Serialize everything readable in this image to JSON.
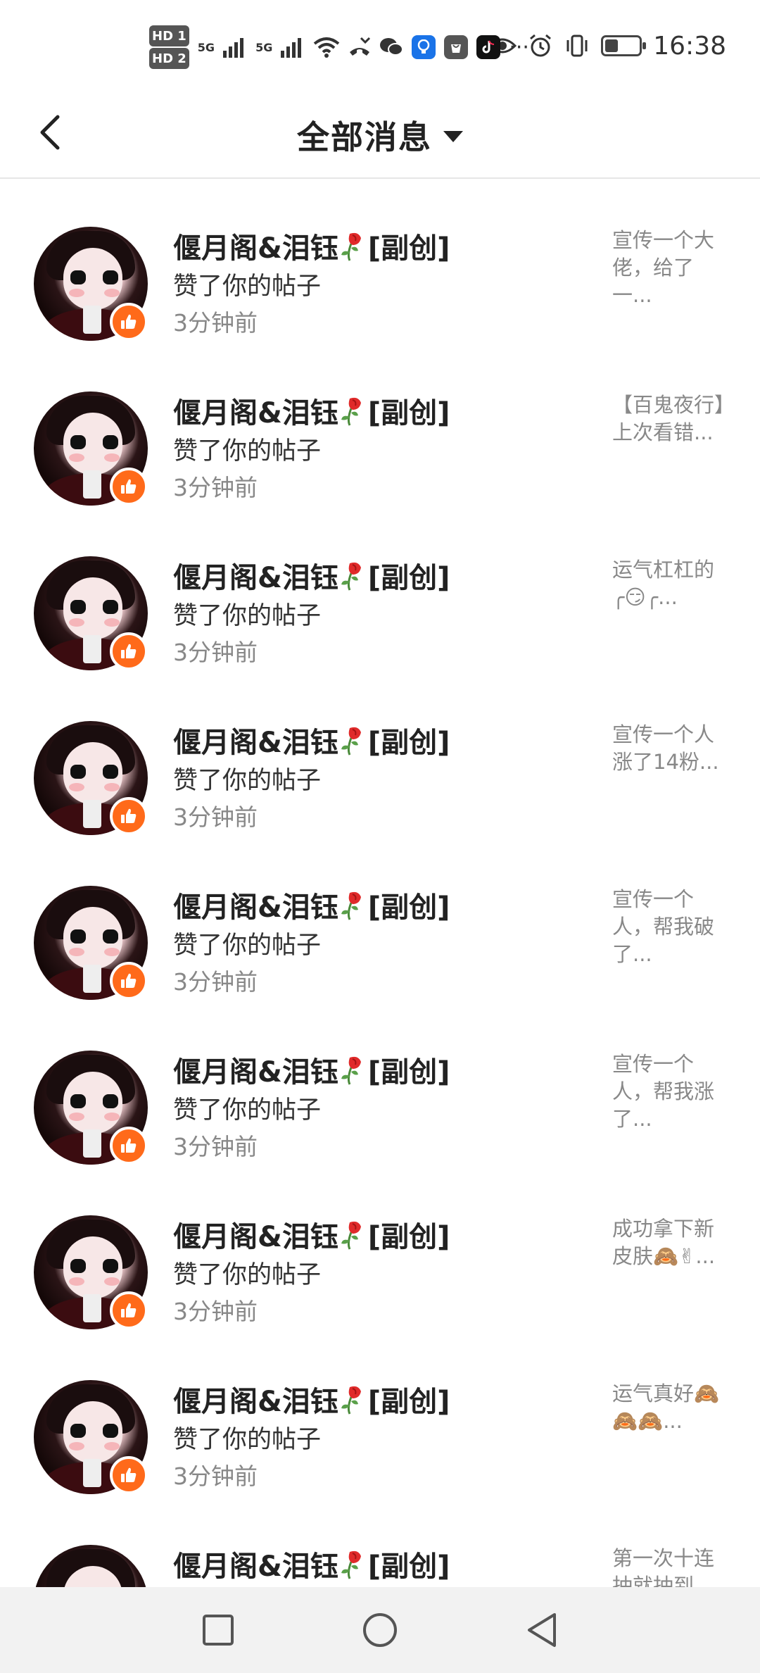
{
  "status_bar": {
    "sim1": "HD 1",
    "sim2": "HD 2",
    "net1": "5G",
    "net2": "5G",
    "time": "16:38",
    "more": "···",
    "icons": [
      "wifi-icon",
      "missed-call-icon",
      "wechat-icon",
      "bulb-app-icon",
      "shopping-app-icon",
      "tiktok-icon",
      "eye-icon",
      "alarm-icon",
      "vibrate-icon",
      "battery-icon"
    ]
  },
  "header": {
    "title": "全部消息"
  },
  "colors": {
    "like_badge": "#ff6a1a",
    "text_primary": "#222222",
    "text_secondary": "#888888",
    "rose": "#e02a2a"
  },
  "messages": [
    {
      "name": "偃月阁&泪钰",
      "tag": "[副创]",
      "action": "赞了你的帖子",
      "time": "3分钟前",
      "preview": "宣传一个大佬，给了一..."
    },
    {
      "name": "偃月阁&泪钰",
      "tag": "[副创]",
      "action": "赞了你的帖子",
      "time": "3分钟前",
      "preview": "【百鬼夜行】上次看错..."
    },
    {
      "name": "偃月阁&泪钰",
      "tag": "[副创]",
      "action": "赞了你的帖子",
      "time": "3分钟前",
      "preview": "运气杠杠的╭😏╭..."
    },
    {
      "name": "偃月阁&泪钰",
      "tag": "[副创]",
      "action": "赞了你的帖子",
      "time": "3分钟前",
      "preview": "宣传一个人涨了14粉..."
    },
    {
      "name": "偃月阁&泪钰",
      "tag": "[副创]",
      "action": "赞了你的帖子",
      "time": "3分钟前",
      "preview": "宣传一个人，帮我破了..."
    },
    {
      "name": "偃月阁&泪钰",
      "tag": "[副创]",
      "action": "赞了你的帖子",
      "time": "3分钟前",
      "preview": "宣传一个人，帮我涨了..."
    },
    {
      "name": "偃月阁&泪钰",
      "tag": "[副创]",
      "action": "赞了你的帖子",
      "time": "3分钟前",
      "preview": "成功拿下新皮肤🙈✌..."
    },
    {
      "name": "偃月阁&泪钰",
      "tag": "[副创]",
      "action": "赞了你的帖子",
      "time": "3分钟前",
      "preview": "运气真好🙈🙈🙈..."
    },
    {
      "name": "偃月阁&泪钰",
      "tag": "[副创]",
      "action": "",
      "time": "",
      "preview": "第一次十连抽就抽到..."
    }
  ],
  "nav": {
    "recent": "recent-apps-button",
    "home": "home-button",
    "back": "back-button"
  }
}
